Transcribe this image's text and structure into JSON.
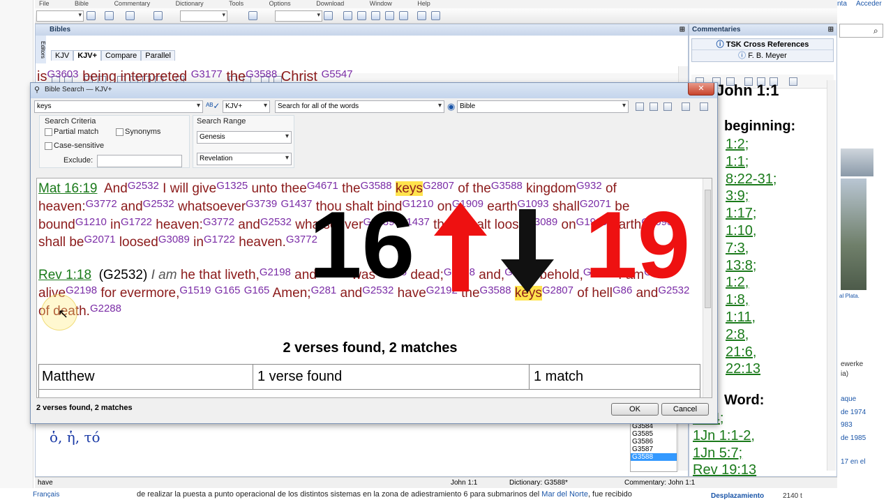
{
  "menu": [
    "File",
    "Bible",
    "Commentary",
    "Dictionary",
    "Tools",
    "Options",
    "Download",
    "Window",
    "Help"
  ],
  "bibles_pane": {
    "title": "Bibles",
    "side_label": "Editors",
    "tabs": [
      "KJV",
      "KJV+",
      "Compare",
      "Parallel"
    ],
    "partial_line": [
      "is",
      "G3603",
      "being interpreted",
      "G3177",
      "the",
      "G3588",
      "Christ",
      "G5547"
    ],
    "greek_text": "ὁ, ἡ, τό"
  },
  "commentaries_pane": {
    "title": "Commentaries",
    "tabs": [
      "TSK Cross References",
      "F. B. Meyer"
    ],
    "heading": "John 1:1",
    "beginning_label": "beginning:",
    "refs1": [
      "1:2;",
      "1:1;",
      "8:22-31;",
      "3:9;",
      "1:17;",
      "1:10,",
      "7:3,",
      "13:8;",
      "1:2,",
      "1:8,",
      "1:11,",
      "2:8,",
      "21:6,",
      "22:13"
    ],
    "word_label": "Word:",
    "refs2": [
      "1:14;",
      "1Jn 1:1-2,",
      "1Jn 5:7;",
      "Rev 19:13"
    ]
  },
  "dialog": {
    "title": "Bible Search — KJV+",
    "search_value": "keys",
    "version": "KJV+",
    "mode": "Search for all of the words",
    "scope": "Bible",
    "criteria_label": "Search Criteria",
    "partial_match": "Partial match",
    "synonyms": "Synonyms",
    "case_sensitive": "Case-sensitive",
    "exclude": "Exclude:",
    "range_label": "Search Range",
    "range_from": "Genesis",
    "range_to": "Revelation",
    "summary": "2 verses found, 2 matches",
    "table": [
      [
        "Matthew",
        "1 verse found",
        "1 match"
      ]
    ],
    "status": "2 verses found, 2 matches",
    "ok": "OK",
    "cancel": "Cancel",
    "verse1_ref": "Mat 16:19",
    "verse2_ref": "Rev 1:18",
    "verse2_tag": "(G2532)",
    "keyword": "keys"
  },
  "overlay": {
    "left_num": "16",
    "right_num": "19",
    "up_color": "#ee1111",
    "down_color": "#000000"
  },
  "strong_list": [
    "G3584",
    "G3585",
    "G3586",
    "G3587",
    "G3588"
  ],
  "statusbar": {
    "word": "have",
    "verse": "John 1:1",
    "dictionary": "Dictionary: G3588*",
    "commentary": "Commentary: John 1:1"
  },
  "right_web": {
    "acceder": "Acceder",
    "partial1": "nta",
    "plata": "al Plata.",
    "partial_lines": [
      "ewerke",
      "ia)",
      "aque",
      "de 1974",
      "983",
      "de 1985",
      "17 en el"
    ],
    "desplaz": "Desplazamiento",
    "desplaz_val": "2140 t"
  },
  "bottom_web": {
    "text": "de realizar la puesta a punto operacional de los distintos sistemas en la zona de adiestramiento 6 para submarinos del",
    "link": "Mar del Norte",
    "text2": ", fue recibido",
    "lang": "Français"
  }
}
